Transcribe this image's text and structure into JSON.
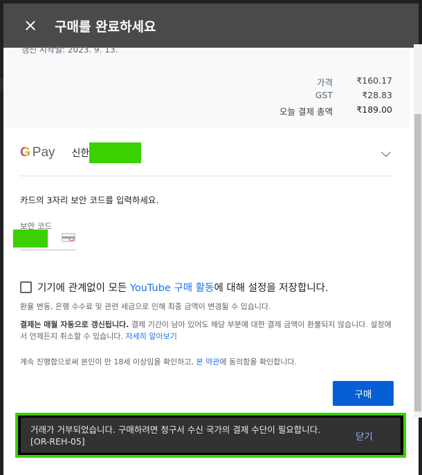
{
  "header": {
    "title": "구매를 완료하세요"
  },
  "summary": {
    "cut_text": "갱신 시작일: 2023. 9. 13.",
    "rows": [
      {
        "label": "가격",
        "value": "₹160.17"
      },
      {
        "label": "GST",
        "value": "₹28.83"
      },
      {
        "label": "오늘 결제 총액",
        "value": "₹189.00"
      }
    ]
  },
  "payment": {
    "gpay_g": "G",
    "gpay_pay": "Pay",
    "card_name": "신한"
  },
  "cvc": {
    "prompt": "카드의 3자리 보안 코드를 입력하세요.",
    "label": "보안 코드"
  },
  "save": {
    "prefix": "기기에 관계없이 모든 ",
    "link": "YouTube 구매 활동",
    "suffix": "에 대해 설정을 저장합니다."
  },
  "notes": {
    "fx": "환율 변동, 은행 수수료 및 관련 세금으로 인해 최종 금액이 변경될 수 있습니다.",
    "renew_bold": "결제는 매월 자동으로 갱신됩니다.",
    "renew_text": " 결제 기간이 남아 있어도 해당 부분에 대한 결제 금액이 환불되지 않습니다. 설정에서 언제든지 취소할 수 있습니다. ",
    "renew_link": "자세히 알아보기",
    "age_prefix": "계속 진행함으로써 본인이 만 18세 이상임을 확인하고, ",
    "age_link": "본 약관",
    "age_suffix": "에 동의함을 확인합니다."
  },
  "buy_button": "구매",
  "snackbar": {
    "message": "거래가 거부되었습니다. 구매하려면 청구서 수신 국가의 결제 수단이 필요합니다. [OR-REH-05]",
    "close": "닫기"
  },
  "colors": {
    "header_bg": "#4a4a4a",
    "accent": "#065fd4",
    "link": "#1a73e8",
    "highlight": "#3bd100"
  }
}
